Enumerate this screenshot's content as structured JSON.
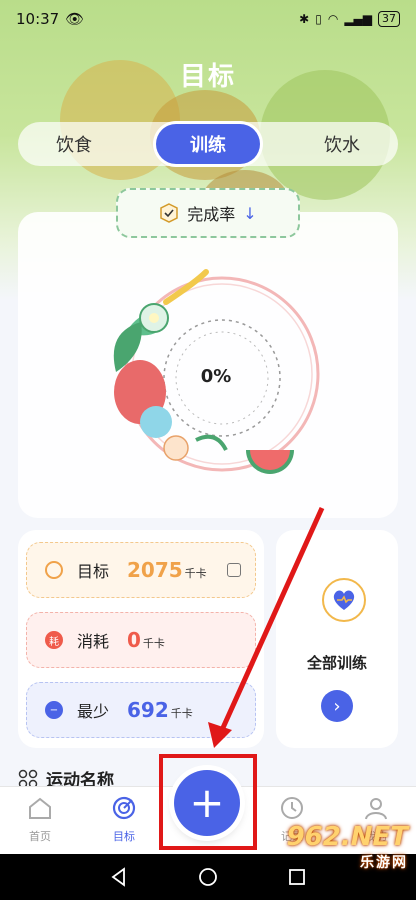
{
  "status_bar": {
    "time": "10:37",
    "battery": "37"
  },
  "header": {
    "title": "目标"
  },
  "tabs": [
    {
      "label": "饮食",
      "active": false
    },
    {
      "label": "训练",
      "active": true
    },
    {
      "label": "饮水",
      "active": false
    }
  ],
  "progress": {
    "button_label": "完成率",
    "sort_icon": "arrow-down-icon",
    "percent_text": "0%",
    "value": 0
  },
  "stats": [
    {
      "label": "目标",
      "value": "2075",
      "unit": "千卡",
      "color": "#f0a24a",
      "icon": "target-icon",
      "editable": true
    },
    {
      "label": "消耗",
      "value": "0",
      "unit": "千卡",
      "color": "#ef5b4b",
      "icon": "burn-icon",
      "icon_text": "耗",
      "editable": false
    },
    {
      "label": "最少",
      "value": "692",
      "unit": "千卡",
      "color": "#4a63e6",
      "icon": "minus-icon",
      "editable": false
    }
  ],
  "all_training": {
    "label": "全部训练",
    "icon": "heart-shield-icon",
    "go_icon": "chevron-right-icon"
  },
  "section": {
    "title": "运动名称",
    "icon": "grid-icon"
  },
  "bottom_nav": [
    {
      "label": "首页",
      "icon": "home-icon",
      "active": false
    },
    {
      "label": "目标",
      "icon": "target-icon",
      "active": true
    },
    {
      "label": "",
      "icon": "plus-icon",
      "active": false
    },
    {
      "label": "记录",
      "icon": "clock-icon",
      "active": false
    },
    {
      "label": "我的",
      "icon": "user-icon",
      "active": false
    }
  ],
  "watermark": {
    "line1": "962.NET",
    "line2": "乐游网"
  },
  "colors": {
    "accent": "#4a63e6",
    "annotation_red": "#e01818",
    "hero_green": "#b9dd8a"
  }
}
